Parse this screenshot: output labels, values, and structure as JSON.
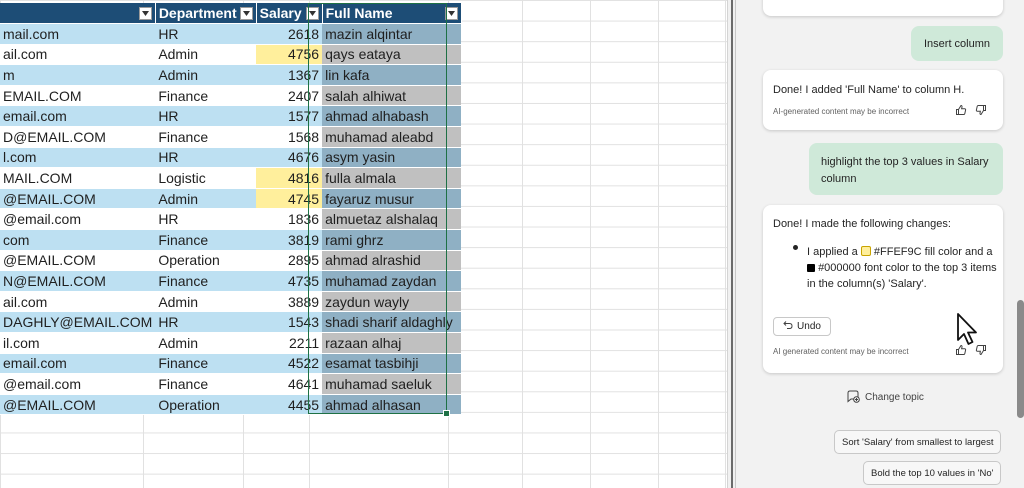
{
  "sheet": {
    "headers": {
      "email": "",
      "department": "Department",
      "salary": "Salary",
      "full_name": "Full Name"
    },
    "rows": [
      {
        "email": "mail.com",
        "department": "HR",
        "salary": "2618",
        "full_name": "mazin alqintar",
        "band": true,
        "highlight": false
      },
      {
        "email": "ail.com",
        "department": "Admin",
        "salary": "4756",
        "full_name": "qays eataya",
        "band": false,
        "highlight": true
      },
      {
        "email": "m",
        "department": "Admin",
        "salary": "1367",
        "full_name": "lin kafa",
        "band": true,
        "highlight": false
      },
      {
        "email": "EMAIL.COM",
        "department": "Finance",
        "salary": "2407",
        "full_name": "salah alhiwat",
        "band": false,
        "highlight": false
      },
      {
        "email": "email.com",
        "department": "HR",
        "salary": "1577",
        "full_name": "ahmad alhabash",
        "band": true,
        "highlight": false
      },
      {
        "email": "D@EMAIL.COM",
        "department": "Finance",
        "salary": "1568",
        "full_name": "muhamad aleabd",
        "band": false,
        "highlight": false
      },
      {
        "email": "l.com",
        "department": "HR",
        "salary": "4676",
        "full_name": "asym yasin",
        "band": true,
        "highlight": false
      },
      {
        "email": "MAIL.COM",
        "department": "Logistic",
        "salary": "4816",
        "full_name": "fulla almala",
        "band": false,
        "highlight": true
      },
      {
        "email": "@EMAIL.COM",
        "department": "Admin",
        "salary": "4745",
        "full_name": "fayaruz musur",
        "band": true,
        "highlight": true
      },
      {
        "email": "@email.com",
        "department": "HR",
        "salary": "1836",
        "full_name": "almuetaz alshalaq",
        "band": false,
        "highlight": false
      },
      {
        "email": "com",
        "department": "Finance",
        "salary": "3819",
        "full_name": "rami ghrz",
        "band": true,
        "highlight": false
      },
      {
        "email": "@EMAIL.COM",
        "department": "Operation",
        "salary": "2895",
        "full_name": "ahmad alrashid",
        "band": false,
        "highlight": false
      },
      {
        "email": "N@EMAIL.COM",
        "department": "Finance",
        "salary": "4735",
        "full_name": "muhamad zaydan",
        "band": true,
        "highlight": false
      },
      {
        "email": "ail.com",
        "department": "Admin",
        "salary": "3889",
        "full_name": "zaydun wayly",
        "band": false,
        "highlight": false
      },
      {
        "email": "DAGHLY@EMAIL.COM",
        "department": "HR",
        "salary": "1543",
        "full_name": "shadi sharif aldaghly",
        "band": true,
        "highlight": false
      },
      {
        "email": "il.com",
        "department": "Admin",
        "salary": "2211",
        "full_name": "razaan alhaj",
        "band": false,
        "highlight": false
      },
      {
        "email": "email.com",
        "department": "Finance",
        "salary": "4522",
        "full_name": "esamat tasbihji",
        "band": true,
        "highlight": false
      },
      {
        "email": "@email.com",
        "department": "Finance",
        "salary": "4641",
        "full_name": "muhamad saeluk",
        "band": false,
        "highlight": false
      },
      {
        "email": "@EMAIL.COM",
        "department": "Operation",
        "salary": "4455",
        "full_name": "ahmad alhasan",
        "band": true,
        "highlight": false
      }
    ]
  },
  "copilot": {
    "msg_insert_column": "Insert column",
    "reply_1": "Done! I added 'Full Name' to column H.",
    "disclaimer_1": "AI-generated content may be incorrect",
    "msg_highlight": "highlight the top 3 values in Salary column",
    "reply_2_title": "Done! I made the following changes:",
    "reply_2_bullet_a": "I applied a",
    "reply_2_fill_hex": "#FFEF9C",
    "reply_2_bullet_b": "fill color and a",
    "reply_2_font_hex": "#000000",
    "reply_2_bullet_c": "font color to the top 3 items in the column(s) 'Salary'.",
    "undo_label": "Undo",
    "disclaimer_2": "AI generated content may be incorrect",
    "change_topic": "Change topic",
    "suggestion_1": "Sort 'Salary' from smallest to largest",
    "suggestion_2": "Bold the top 10 values in 'No'",
    "fill_swatch_color": "#FFEF9C",
    "font_swatch_color": "#000000"
  },
  "colors": {
    "header_bg": "#1d4d76",
    "band_blue": "#bde0f2",
    "highlight_yellow": "#ffef9c",
    "user_bubble_green": "#cfe9d9"
  }
}
